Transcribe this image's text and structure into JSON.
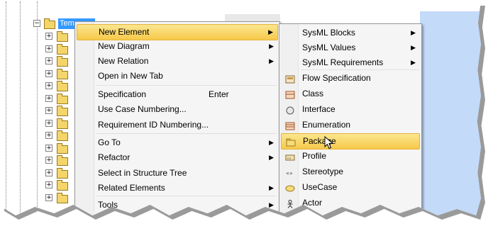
{
  "tree": {
    "selected_label": "Temp"
  },
  "context_menu": {
    "items": [
      {
        "label": "New Element",
        "submenu": true,
        "highlighted": true
      },
      {
        "label": "New Diagram",
        "submenu": true
      },
      {
        "label": "New Relation",
        "submenu": true
      },
      {
        "label": "Open in New Tab"
      },
      {
        "label": "Specification",
        "shortcut": "Enter"
      },
      {
        "label": "Use Case Numbering..."
      },
      {
        "label": "Requirement ID Numbering..."
      },
      {
        "label": "Go To",
        "submenu": true
      },
      {
        "label": "Refactor",
        "submenu": true
      },
      {
        "label": "Select in Structure Tree"
      },
      {
        "label": "Related Elements",
        "submenu": true
      },
      {
        "label": "Tools",
        "submenu": true
      }
    ]
  },
  "submenu": {
    "items": [
      {
        "label": "SysML Blocks",
        "submenu": true,
        "icon": "none"
      },
      {
        "label": "SysML Values",
        "submenu": true,
        "icon": "none"
      },
      {
        "label": "SysML Requirements",
        "submenu": true,
        "icon": "none"
      },
      {
        "label": "Flow Specification",
        "icon": "flow-spec-icon"
      },
      {
        "label": "Class",
        "icon": "class-icon"
      },
      {
        "label": "Interface",
        "icon": "interface-icon"
      },
      {
        "label": "Enumeration",
        "icon": "enumeration-icon"
      },
      {
        "label": "Package",
        "icon": "package-icon",
        "highlighted": true
      },
      {
        "label": "Profile",
        "icon": "profile-icon"
      },
      {
        "label": "Stereotype",
        "icon": "stereotype-icon"
      },
      {
        "label": "UseCase",
        "icon": "usecase-icon"
      },
      {
        "label": "Actor",
        "icon": "actor-icon"
      }
    ]
  },
  "colors": {
    "highlight": "#f8d35c",
    "selection": "#3399ff",
    "app_background": "#c3daf8"
  }
}
